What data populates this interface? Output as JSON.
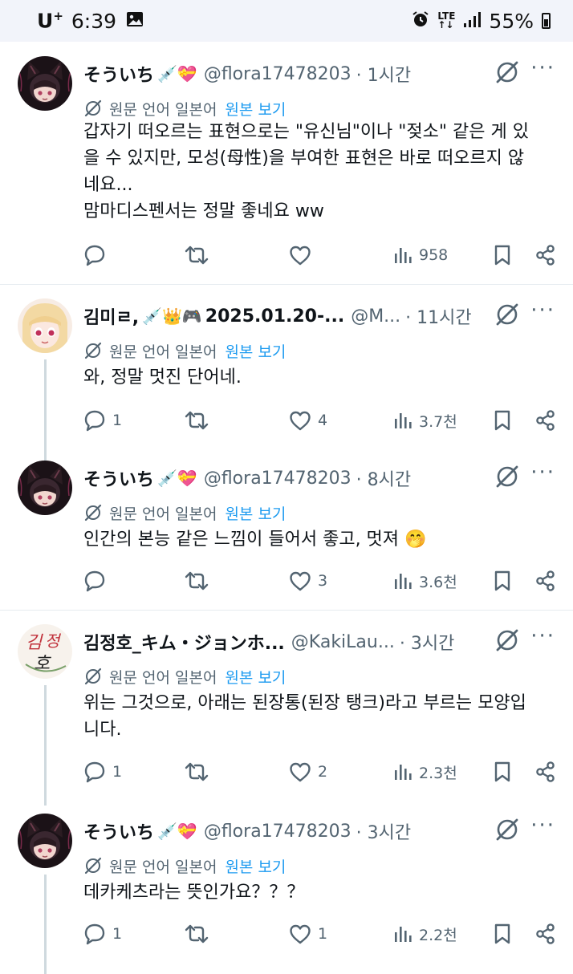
{
  "status_bar": {
    "carrier": "U",
    "carrier_sup": "+",
    "time": "6:39",
    "network_top": "LTE",
    "network_bottom": "↑↓",
    "battery": "55%"
  },
  "translation": {
    "label": "원문 언어 일본어",
    "link": "원본 보기"
  },
  "tweets": [
    {
      "name": "そういち",
      "emoji": "💉💝",
      "handle": "@flora17478203",
      "time": "· 1시간",
      "body": [
        "갑자기 떠오르는 표현으로는 \"유신님\"이나 \"젖소\" 같은 게 있",
        "을 수 있지만, 모성(母性)을 부여한 표현은 바로 떠오르지 않",
        "네요...",
        "맘마디스펜서는 정말 좋네요 ww"
      ],
      "replies": "",
      "retweets": "",
      "likes": "",
      "views": "958"
    },
    {
      "name": "김미ㄹ,",
      "emoji": "💉👑🎮",
      "name_suffix": "2025.01.20-...",
      "handle": "@M...",
      "time": "· 11시간",
      "body": [
        "와, 정말 멋진 단어네."
      ],
      "replies": "1",
      "retweets": "",
      "likes": "4",
      "views": "3.7천"
    },
    {
      "name": "そういち",
      "emoji": "💉💝",
      "handle": "@flora17478203",
      "time": "· 8시간",
      "body": [
        "인간의 본능 같은 느낌이 들어서 좋고, 멋져 🤭"
      ],
      "replies": "",
      "retweets": "",
      "likes": "3",
      "views": "3.6천"
    },
    {
      "name": "김정호_キム・ジョンホ...",
      "emoji": "",
      "avatar_text": "김정호",
      "handle": "@KakiLau...",
      "time": "· 3시간",
      "body": [
        "위는 그것으로, 아래는 된장통(된장 탱크)라고 부르는 모양입",
        "니다."
      ],
      "replies": "1",
      "retweets": "",
      "likes": "2",
      "views": "2.3천"
    },
    {
      "name": "そういち",
      "emoji": "💉💝",
      "handle": "@flora17478203",
      "time": "· 3시간",
      "body": [
        "데카케츠라는 뜻인가요？？？"
      ],
      "replies": "1",
      "retweets": "",
      "likes": "1",
      "views": "2.2천"
    }
  ],
  "colors": {
    "text": "#0f1419",
    "muted": "#536471",
    "link": "#1d9bf0",
    "thread_line": "#cfd9de",
    "status_bg": "#f2f4fa"
  }
}
